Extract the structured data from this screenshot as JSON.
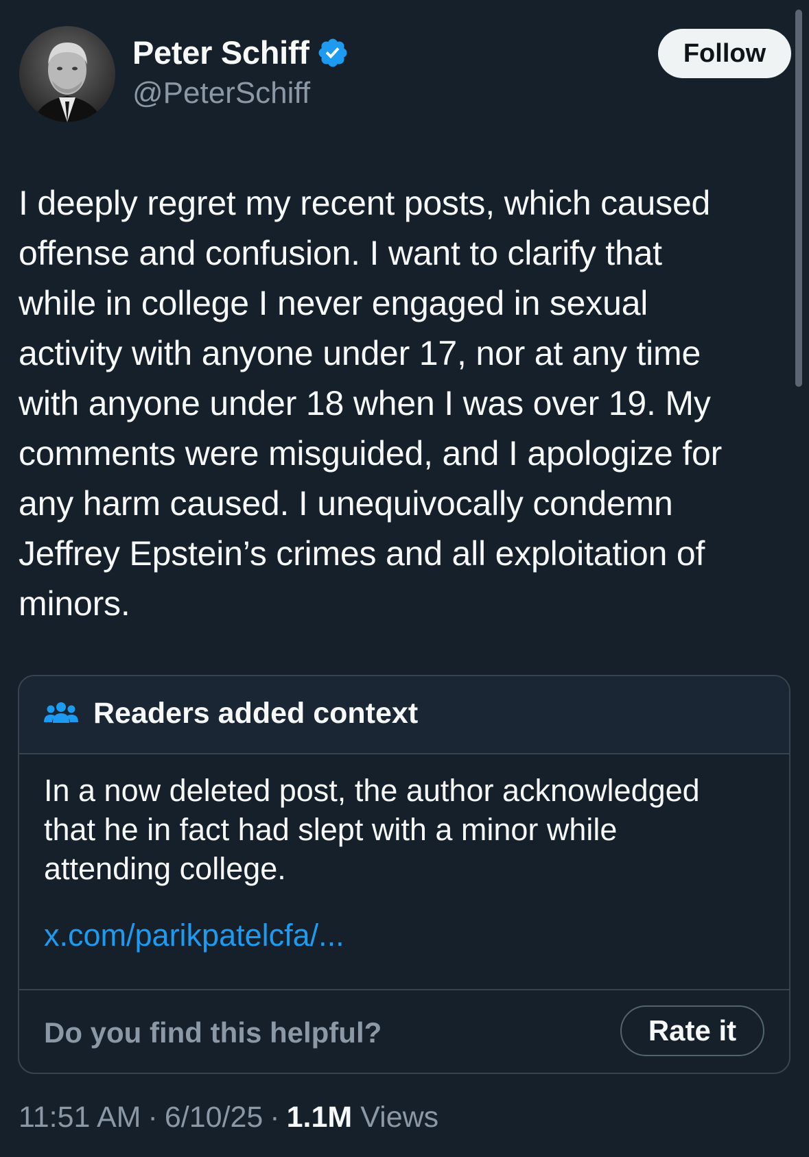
{
  "author": {
    "display_name": "Peter Schiff",
    "handle": "@PeterSchiff",
    "verified": true
  },
  "follow_label": "Follow",
  "tweet": {
    "lines": [
      "I deeply regret my recent posts, which caused",
      "offense and confusion. I want to clarify that",
      "while in college I never engaged in sexual",
      "activity with anyone under 17, nor at any time",
      "with anyone under 18 when I was over 19. My",
      "comments were misguided, and I apologize for",
      "any harm caused. I unequivocally condemn",
      "Jeffrey Epstein’s crimes and all exploitation of",
      "minors."
    ]
  },
  "community_note": {
    "icon": "people-icon",
    "title": "Readers added context",
    "body_lines": [
      "In a now deleted post, the author acknowledged",
      "that he in fact had slept with a minor while",
      "attending college."
    ],
    "link": "x.com/parikpatelcfa/...",
    "helpful_prompt": "Do you find this helpful?",
    "rate_label": "Rate it"
  },
  "meta": {
    "time": "11:51 AM",
    "separator": "·",
    "date": "6/10/25",
    "views_count": "1.1M",
    "views_label": "Views"
  },
  "colors": {
    "background": "#15202b",
    "text": "#f7f9f9",
    "secondary": "#8b98a5",
    "accent": "#1d9bf0",
    "border": "#38444d"
  }
}
